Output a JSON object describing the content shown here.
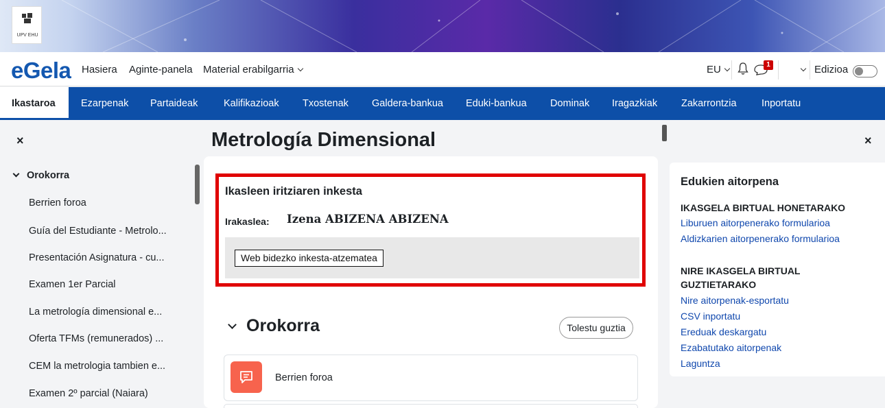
{
  "banner": {
    "logo_caption": "UPV EHU"
  },
  "topnav": {
    "brand": "eGela",
    "links": [
      "Hasiera",
      "Aginte-panela",
      "Material erabilgarria"
    ],
    "language": "EU",
    "notification_count": "1",
    "edit_mode_label": "Edizioa",
    "edit_mode_on": false
  },
  "secnav": {
    "tabs": [
      "Ikastaroa",
      "Ezarpenak",
      "Partaideak",
      "Kalifikazioak",
      "Txostenak",
      "Galdera-bankua",
      "Eduki-bankua",
      "Dominak",
      "Iragazkiak",
      "Zakarrontzia",
      "Inportatu"
    ],
    "active": "Ikastaroa"
  },
  "left_drawer": {
    "close": "×",
    "section": "Orokorra",
    "items": [
      "Berrien foroa",
      "Guía del Estudiante - Metrolo...",
      "Presentación Asignatura - cu...",
      "Examen 1er Parcial",
      "La metrología dimensional e...",
      "Oferta TFMs (remunerados) ...",
      "CEM la metrologia tambien e...",
      "Examen 2º parcial (Naiara)"
    ]
  },
  "main": {
    "course_title": "Metrología Dimensional",
    "survey": {
      "title": "Ikasleen iritziaren inkesta",
      "teacher_label": "Irakaslea:",
      "teacher_name": "Izena ABIZENA ABIZENA",
      "button": "Web bidezko inkesta-atzematea"
    },
    "section_title": "Orokorra",
    "collapse_all": "Tolestu guztia",
    "activity": "Berrien foroa"
  },
  "right_drawer": {
    "close": "×",
    "title": "Edukien aitorpena",
    "group1_heading": "IKASGELA BIRTUAL HONETARAKO",
    "group1_links": [
      "Liburuen aitorpenerako formularioa",
      "Aldizkarien aitorpenerako formularioa"
    ],
    "group2_heading_line1": "NIRE IKASGELA BIRTUAL",
    "group2_heading_line2": "GUZTIETARAKO",
    "group2_links": [
      "Nire aitorpenak-esportatu",
      "CSV inportatu",
      "Ereduak deskargatu",
      "Ezabatutako aitorpenak",
      "Laguntza"
    ]
  },
  "colors": {
    "brand": "#1458b0",
    "nav_blue": "#0d4fa8",
    "highlight_red": "#e00000",
    "forum_icon": "#f7634d",
    "link": "#0f47ad"
  }
}
